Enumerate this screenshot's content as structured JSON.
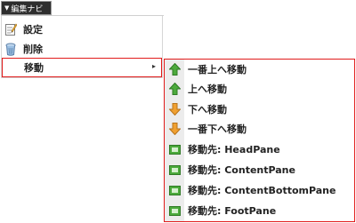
{
  "nav_button": {
    "arrow": "▼",
    "label": "編集ナビ"
  },
  "primary_menu": {
    "items": [
      {
        "label": "設定",
        "icon": "settings-icon"
      },
      {
        "label": "削除",
        "icon": "trash-icon"
      },
      {
        "label": "移動",
        "icon": "none",
        "submenu_arrow": "▸"
      }
    ]
  },
  "move_submenu": {
    "items": [
      {
        "label": "一番上へ移動",
        "icon": "arrow-up-icon"
      },
      {
        "label": "上へ移動",
        "icon": "arrow-up-icon"
      },
      {
        "label": "下へ移動",
        "icon": "arrow-down-icon"
      },
      {
        "label": "一番下へ移動",
        "icon": "arrow-down-icon"
      },
      {
        "label": "移動先: HeadPane",
        "icon": "pane-icon"
      },
      {
        "label": "移動先: ContentPane",
        "icon": "pane-icon"
      },
      {
        "label": "移動先: ContentBottomPane",
        "icon": "pane-icon"
      },
      {
        "label": "移動先: FootPane",
        "icon": "pane-icon"
      }
    ]
  },
  "colors": {
    "highlight_border": "#e11b1b",
    "arrow_up": "#4caa3c",
    "arrow_down": "#f0a030",
    "pane_icon": "#4caa3c",
    "nav_button_bg": "#2e2e2e"
  }
}
